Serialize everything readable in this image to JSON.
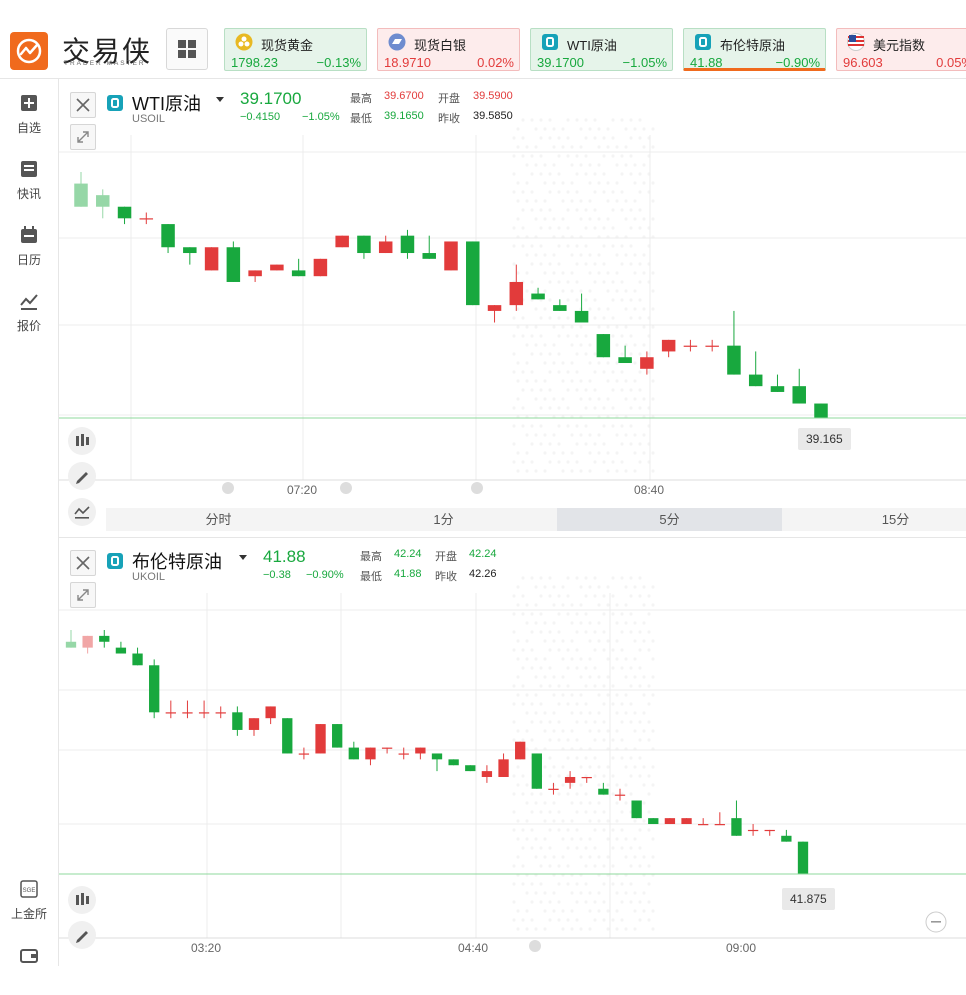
{
  "app": {
    "name": "交易侠",
    "name_en": "TRADER MASTER"
  },
  "colors": {
    "brand": "#f06a1d",
    "up": "#e23b3b",
    "down": "#18a83e",
    "price_line": "#8fd99c"
  },
  "tickers": [
    {
      "name": "现货黄金",
      "price": "1798.23",
      "change": "−0.13%",
      "dir": "down",
      "icon": "gold-coins-icon"
    },
    {
      "name": "现货白银",
      "price": "18.9710",
      "change": "0.02%",
      "dir": "up",
      "icon": "silver-bar-icon"
    },
    {
      "name": "WTI原油",
      "price": "39.1700",
      "change": "−1.05%",
      "dir": "down",
      "icon": "oil-badge-icon"
    },
    {
      "name": "布伦特原油",
      "price": "41.88",
      "change": "−0.90%",
      "dir": "down",
      "icon": "oil-badge-icon",
      "active": true
    },
    {
      "name": "美元指数",
      "price": "96.603",
      "change": "0.05%",
      "dir": "up",
      "icon": "us-flag-icon"
    }
  ],
  "sidebar": [
    {
      "label": "自选",
      "icon": "add-favorite-icon"
    },
    {
      "label": "快讯",
      "icon": "news-icon"
    },
    {
      "label": "日历",
      "icon": "calendar-icon"
    },
    {
      "label": "报价",
      "icon": "quote-chart-icon"
    },
    {
      "label": "上金所",
      "icon": "sge-icon"
    }
  ],
  "panels": [
    {
      "title": "WTI原油",
      "symbol": "USOIL",
      "price": "39.1700",
      "change": "−0.4150",
      "change_pct": "−1.05%",
      "stats": {
        "high_label": "最高",
        "high": "39.6700",
        "open_label": "开盘",
        "open": "39.5900",
        "low_label": "最低",
        "low": "39.1650",
        "prev_label": "昨收",
        "prev": "39.5850"
      },
      "last_price": "39.165",
      "x_labels": [
        "07:20",
        "08:40"
      ],
      "tabs": [
        "分时",
        "1分",
        "5分",
        "15分"
      ],
      "active_tab": "5分"
    },
    {
      "title": "布伦特原油",
      "symbol": "UKOIL",
      "price": "41.88",
      "change": "−0.38",
      "change_pct": "−0.90%",
      "stats": {
        "high_label": "最高",
        "high": "42.24",
        "open_label": "开盘",
        "open": "42.24",
        "low_label": "最低",
        "low": "41.88",
        "prev_label": "昨收",
        "prev": "42.26"
      },
      "last_price": "41.875",
      "x_labels": [
        "03:20",
        "04:40",
        "09:00"
      ]
    }
  ],
  "chart_data": [
    {
      "type": "candlestick",
      "symbol": "USOIL",
      "x": [
        "07:20",
        "08:40"
      ],
      "ohlc": [
        [
          39.57,
          39.59,
          39.53,
          39.53
        ],
        [
          39.55,
          39.56,
          39.51,
          39.53
        ],
        [
          39.53,
          39.53,
          39.5,
          39.51
        ],
        [
          39.51,
          39.52,
          39.5,
          39.51
        ],
        [
          39.5,
          39.5,
          39.45,
          39.46
        ],
        [
          39.46,
          39.46,
          39.43,
          39.45
        ],
        [
          39.42,
          39.46,
          39.42,
          39.46
        ],
        [
          39.46,
          39.47,
          39.4,
          39.4
        ],
        [
          39.41,
          39.42,
          39.4,
          39.42
        ],
        [
          39.42,
          39.43,
          39.42,
          39.43
        ],
        [
          39.42,
          39.44,
          39.41,
          39.41
        ],
        [
          39.41,
          39.44,
          39.41,
          39.44
        ],
        [
          39.46,
          39.48,
          39.46,
          39.48
        ],
        [
          39.48,
          39.48,
          39.44,
          39.45
        ],
        [
          39.45,
          39.48,
          39.45,
          39.47
        ],
        [
          39.48,
          39.49,
          39.44,
          39.45
        ],
        [
          39.45,
          39.48,
          39.44,
          39.44
        ],
        [
          39.42,
          39.47,
          39.42,
          39.47
        ],
        [
          39.47,
          39.47,
          39.36,
          39.36
        ],
        [
          39.35,
          39.36,
          39.33,
          39.36
        ],
        [
          39.36,
          39.43,
          39.35,
          39.4
        ],
        [
          39.38,
          39.39,
          39.37,
          39.37
        ],
        [
          39.36,
          39.37,
          39.35,
          39.35
        ],
        [
          39.35,
          39.38,
          39.33,
          39.33
        ],
        [
          39.31,
          39.31,
          39.27,
          39.27
        ],
        [
          39.27,
          39.29,
          39.26,
          39.26
        ],
        [
          39.25,
          39.28,
          39.24,
          39.27
        ],
        [
          39.28,
          39.3,
          39.27,
          39.3
        ],
        [
          39.29,
          39.3,
          39.28,
          39.29
        ],
        [
          39.29,
          39.3,
          39.28,
          39.29
        ],
        [
          39.29,
          39.35,
          39.24,
          39.24
        ],
        [
          39.24,
          39.28,
          39.22,
          39.22
        ],
        [
          39.22,
          39.24,
          39.21,
          39.21
        ],
        [
          39.22,
          39.25,
          39.19,
          39.19
        ],
        [
          39.19,
          39.19,
          39.165,
          39.165
        ]
      ],
      "last": 39.165
    },
    {
      "type": "candlestick",
      "symbol": "UKOIL",
      "x": [
        "03:20",
        "04:40",
        "09:00"
      ],
      "ohlc": [
        [
          42.27,
          42.29,
          42.26,
          42.26
        ],
        [
          42.26,
          42.28,
          42.25,
          42.28
        ],
        [
          42.28,
          42.29,
          42.26,
          42.27
        ],
        [
          42.26,
          42.27,
          42.25,
          42.25
        ],
        [
          42.25,
          42.26,
          42.23,
          42.23
        ],
        [
          42.23,
          42.24,
          42.14,
          42.15
        ],
        [
          42.15,
          42.17,
          42.14,
          42.15
        ],
        [
          42.15,
          42.17,
          42.14,
          42.15
        ],
        [
          42.15,
          42.17,
          42.14,
          42.15
        ],
        [
          42.15,
          42.16,
          42.14,
          42.15
        ],
        [
          42.15,
          42.16,
          42.11,
          42.12
        ],
        [
          42.12,
          42.14,
          42.11,
          42.14
        ],
        [
          42.14,
          42.16,
          42.13,
          42.16
        ],
        [
          42.14,
          42.14,
          42.08,
          42.08
        ],
        [
          42.08,
          42.09,
          42.07,
          42.08
        ],
        [
          42.08,
          42.13,
          42.08,
          42.13
        ],
        [
          42.13,
          42.13,
          42.09,
          42.09
        ],
        [
          42.09,
          42.1,
          42.07,
          42.07
        ],
        [
          42.07,
          42.09,
          42.06,
          42.09
        ],
        [
          42.09,
          42.09,
          42.08,
          42.09
        ],
        [
          42.08,
          42.09,
          42.07,
          42.08
        ],
        [
          42.08,
          42.09,
          42.07,
          42.09
        ],
        [
          42.08,
          42.08,
          42.05,
          42.07
        ],
        [
          42.07,
          42.07,
          42.06,
          42.06
        ],
        [
          42.06,
          42.06,
          42.05,
          42.05
        ],
        [
          42.04,
          42.06,
          42.03,
          42.05
        ],
        [
          42.04,
          42.08,
          42.04,
          42.07
        ],
        [
          42.07,
          42.1,
          42.07,
          42.1
        ],
        [
          42.08,
          42.08,
          42.02,
          42.02
        ],
        [
          42.02,
          42.03,
          42.01,
          42.02
        ],
        [
          42.03,
          42.05,
          42.02,
          42.04
        ],
        [
          42.04,
          42.04,
          42.03,
          42.04
        ],
        [
          42.02,
          42.03,
          42.01,
          42.01
        ],
        [
          42.01,
          42.02,
          42.0,
          42.01
        ],
        [
          42.0,
          42.0,
          41.97,
          41.97
        ],
        [
          41.97,
          41.97,
          41.96,
          41.96
        ],
        [
          41.96,
          41.97,
          41.96,
          41.97
        ],
        [
          41.96,
          41.97,
          41.96,
          41.97
        ],
        [
          41.96,
          41.97,
          41.96,
          41.96
        ],
        [
          41.96,
          41.98,
          41.96,
          41.96
        ],
        [
          41.97,
          42.0,
          41.94,
          41.94
        ],
        [
          41.95,
          41.96,
          41.94,
          41.95
        ],
        [
          41.95,
          41.95,
          41.94,
          41.95
        ],
        [
          41.94,
          41.95,
          41.93,
          41.93
        ],
        [
          41.93,
          41.93,
          41.875,
          41.875
        ]
      ],
      "last": 41.875
    }
  ]
}
